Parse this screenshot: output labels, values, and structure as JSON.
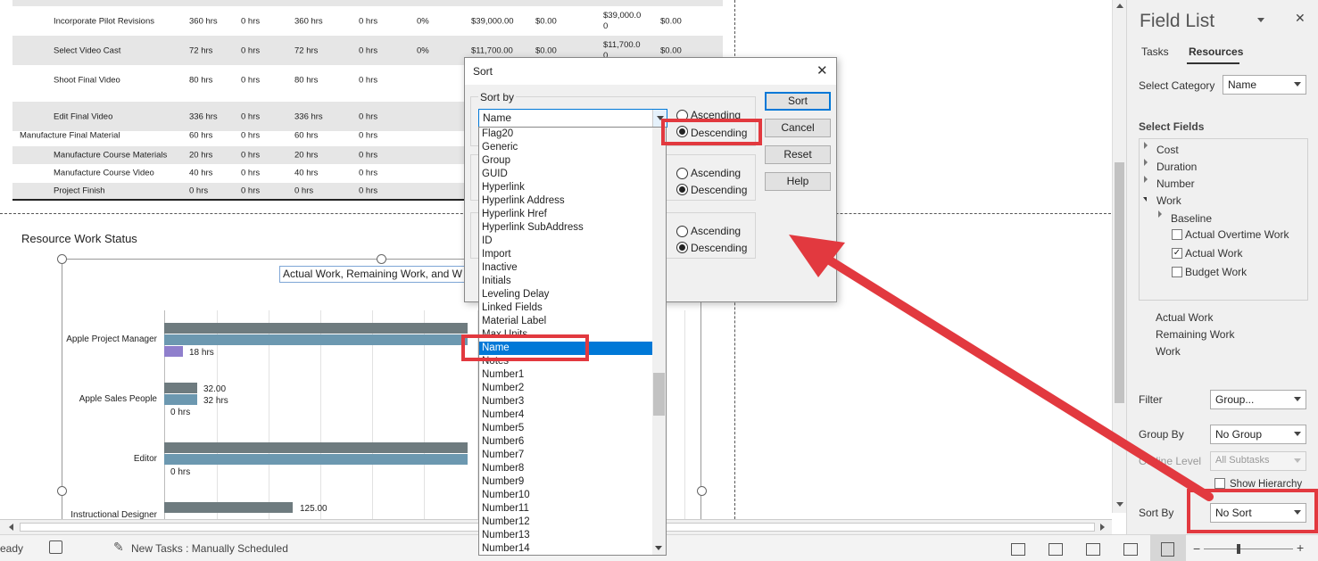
{
  "table": {
    "rows": [
      {
        "name": "Incorporate Pilot Revisions",
        "work": "360 hrs",
        "ot": "0 hrs",
        "aw": "360 hrs",
        "rw": "0 hrs",
        "pct": "0%",
        "cost": "$39,000.00",
        "c2": "$0.00",
        "c3": "$39,000.0\n0",
        "c4": "$0.00",
        "indent": true,
        "shaded": false
      },
      {
        "name": "Select Video Cast",
        "work": "72 hrs",
        "ot": "0 hrs",
        "aw": "72 hrs",
        "rw": "0 hrs",
        "pct": "0%",
        "cost": "$11,700.00",
        "c2": "$0.00",
        "c3": "$11,700.0\n0",
        "c4": "$0.00",
        "indent": true,
        "shaded": true
      },
      {
        "name": "Shoot Final Video",
        "work": "80 hrs",
        "ot": "0 hrs",
        "aw": "80 hrs",
        "rw": "0 hrs",
        "pct": "",
        "cost": "",
        "c2": "",
        "c3": "",
        "c4": "",
        "indent": true,
        "shaded": false
      },
      {
        "name": "Edit Final Video",
        "work": "336 hrs",
        "ot": "0 hrs",
        "aw": "336 hrs",
        "rw": "0 hrs",
        "pct": "",
        "cost": "",
        "c2": "",
        "c3": "",
        "c4": "",
        "indent": true,
        "shaded": true
      },
      {
        "name": "Manufacture Final Material",
        "work": "60 hrs",
        "ot": "0 hrs",
        "aw": "60 hrs",
        "rw": "0 hrs",
        "pct": "",
        "cost": "",
        "c2": "",
        "c3": "",
        "c4": "",
        "indent": false,
        "shaded": false
      },
      {
        "name": "Manufacture Course Materials",
        "work": "20 hrs",
        "ot": "0 hrs",
        "aw": "20 hrs",
        "rw": "0 hrs",
        "pct": "",
        "cost": "",
        "c2": "",
        "c3": "",
        "c4": "",
        "indent": true,
        "shaded": true
      },
      {
        "name": "Manufacture Course Video",
        "work": "40 hrs",
        "ot": "0 hrs",
        "aw": "40 hrs",
        "rw": "0 hrs",
        "pct": "",
        "cost": "",
        "c2": "",
        "c3": "",
        "c4": "",
        "indent": true,
        "shaded": false
      },
      {
        "name": "Project Finish",
        "work": "0 hrs",
        "ot": "0 hrs",
        "aw": "0 hrs",
        "rw": "0 hrs",
        "pct": "",
        "cost": "",
        "c2": "",
        "c3": "",
        "c4": "",
        "indent": true,
        "shaded": true
      }
    ]
  },
  "report": {
    "title": "Resource Work Status",
    "chart_title": "Actual Work, Remaining Work, and W"
  },
  "chart_data": {
    "type": "bar",
    "orientation": "horizontal",
    "categories": [
      "Apple Project Manager",
      "Apple Sales People",
      "Editor",
      "Instructional Designer"
    ],
    "data_labels": [
      {
        "category": "Apple Project Manager",
        "labels": [
          "18 hrs"
        ]
      },
      {
        "category": "Apple Sales People",
        "labels": [
          "32.00",
          "32 hrs",
          "0 hrs"
        ]
      },
      {
        "category": "Editor",
        "labels": [
          "0 hrs"
        ]
      },
      {
        "category": "Instructional Designer",
        "labels": [
          "125.00"
        ]
      }
    ],
    "series": [
      {
        "values": [
          null,
          32,
          null,
          125
        ],
        "color": "#6e7b7f"
      },
      {
        "values": [
          null,
          32,
          null,
          null
        ],
        "color": "#6c98b0"
      },
      {
        "values": [
          18,
          0,
          0,
          null
        ],
        "color": "#8f7fcc"
      }
    ]
  },
  "dialog": {
    "title": "Sort",
    "close": "✕",
    "sort_by_label": "Sort by",
    "selected_field": "Name",
    "ascending": "Ascending",
    "descending": "Descending",
    "buttons": {
      "sort": "Sort",
      "cancel": "Cancel",
      "reset": "Reset",
      "help": "Help"
    },
    "field_list": [
      "Flag20",
      "Generic",
      "Group",
      "GUID",
      "Hyperlink",
      "Hyperlink Address",
      "Hyperlink Href",
      "Hyperlink SubAddress",
      "ID",
      "Import",
      "Inactive",
      "Initials",
      "Leveling Delay",
      "Linked Fields",
      "Material Label",
      "Max Units",
      "Name",
      "Notes",
      "Number1",
      "Number2",
      "Number3",
      "Number4",
      "Number5",
      "Number6",
      "Number7",
      "Number8",
      "Number9",
      "Number10",
      "Number11",
      "Number12",
      "Number13",
      "Number14"
    ],
    "selected_index": 16
  },
  "field_list": {
    "title": "Field List",
    "tabs": [
      "Tasks",
      "Resources"
    ],
    "active_tab": "Resources",
    "select_category_label": "Select Category",
    "category_value": "Name",
    "select_fields_label": "Select Fields",
    "tree": [
      {
        "label": "Cost",
        "expanded": false
      },
      {
        "label": "Duration",
        "expanded": false
      },
      {
        "label": "Number",
        "expanded": false
      },
      {
        "label": "Work",
        "expanded": true
      }
    ],
    "baseline": "Baseline",
    "checks": [
      {
        "label": "Actual Overtime Work",
        "checked": false
      },
      {
        "label": "Actual Work",
        "checked": true
      },
      {
        "label": "Budget Work",
        "checked": false
      }
    ],
    "selected_fields": [
      "Actual Work",
      "Remaining Work",
      "Work"
    ],
    "filter_label": "Filter",
    "filter_value": "Group...",
    "groupby_label": "Group By",
    "groupby_value": "No Group",
    "outline_label": "Outline Level",
    "outline_value": "All Subtasks",
    "show_hierarchy": "Show Hierarchy",
    "sortby_label": "Sort By",
    "sortby_value": "No Sort"
  },
  "status": {
    "ready": "eady",
    "new_tasks": "New Tasks : Manually Scheduled"
  },
  "annotation_color": "#e2393f"
}
